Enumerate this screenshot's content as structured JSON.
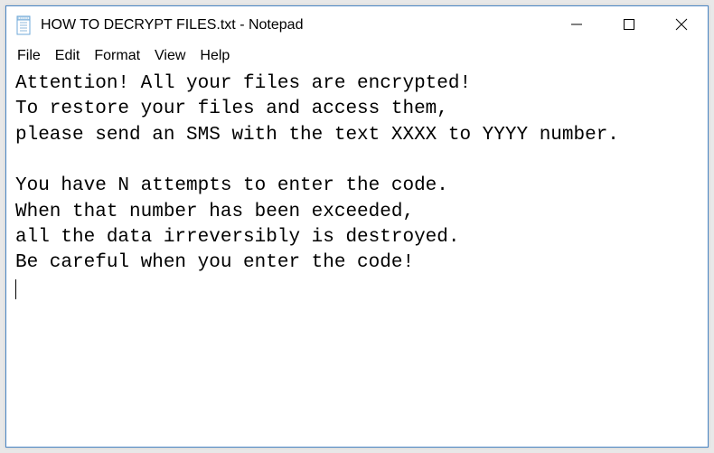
{
  "window": {
    "title": "HOW TO DECRYPT FILES.txt - Notepad"
  },
  "menu": {
    "file": "File",
    "edit": "Edit",
    "format": "Format",
    "view": "View",
    "help": "Help"
  },
  "content": {
    "text": "Attention! All your files are encrypted!\nTo restore your files and access them,\nplease send an SMS with the text XXXX to YYYY number.\n\nYou have N attempts to enter the code.\nWhen that number has been exceeded,\nall the data irreversibly is destroyed.\nBe careful when you enter the code!"
  },
  "icons": {
    "app": "notepad-icon",
    "minimize": "minimize-icon",
    "maximize": "maximize-icon",
    "close": "close-icon"
  }
}
